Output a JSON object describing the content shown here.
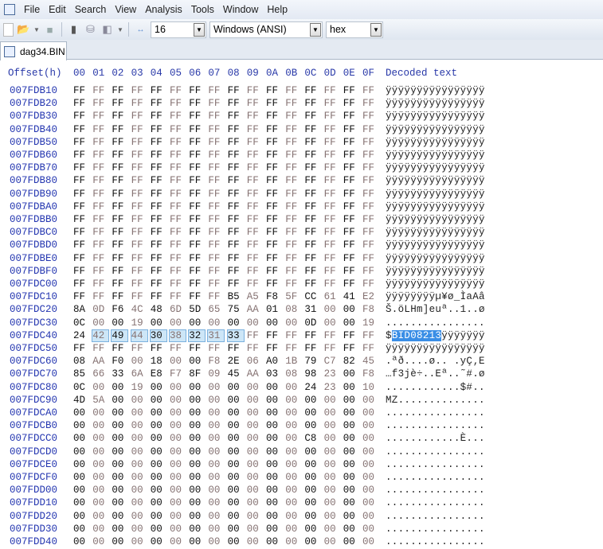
{
  "menu": [
    "File",
    "Edit",
    "Search",
    "View",
    "Analysis",
    "Tools",
    "Window",
    "Help"
  ],
  "toolbar": {
    "bytes_per_row": "16",
    "charset": "Windows (ANSI)",
    "display": "hex"
  },
  "tab": {
    "label": "dag34.BIN"
  },
  "header": {
    "offset": "Offset(h)",
    "columns": [
      "00",
      "01",
      "02",
      "03",
      "04",
      "05",
      "06",
      "07",
      "08",
      "09",
      "0A",
      "0B",
      "0C",
      "0D",
      "0E",
      "0F"
    ],
    "decoded": "Decoded text"
  },
  "selection": {
    "row": "007FDC40",
    "start": 1,
    "length": 8
  },
  "rows": [
    {
      "offset": "007FDB10",
      "bytes": "FF FF FF FF FF FF FF FF FF FF FF FF FF FF FF FF",
      "text": "ÿÿÿÿÿÿÿÿÿÿÿÿÿÿÿÿ"
    },
    {
      "offset": "007FDB20",
      "bytes": "FF FF FF FF FF FF FF FF FF FF FF FF FF FF FF FF",
      "text": "ÿÿÿÿÿÿÿÿÿÿÿÿÿÿÿÿ"
    },
    {
      "offset": "007FDB30",
      "bytes": "FF FF FF FF FF FF FF FF FF FF FF FF FF FF FF FF",
      "text": "ÿÿÿÿÿÿÿÿÿÿÿÿÿÿÿÿ"
    },
    {
      "offset": "007FDB40",
      "bytes": "FF FF FF FF FF FF FF FF FF FF FF FF FF FF FF FF",
      "text": "ÿÿÿÿÿÿÿÿÿÿÿÿÿÿÿÿ"
    },
    {
      "offset": "007FDB50",
      "bytes": "FF FF FF FF FF FF FF FF FF FF FF FF FF FF FF FF",
      "text": "ÿÿÿÿÿÿÿÿÿÿÿÿÿÿÿÿ"
    },
    {
      "offset": "007FDB60",
      "bytes": "FF FF FF FF FF FF FF FF FF FF FF FF FF FF FF FF",
      "text": "ÿÿÿÿÿÿÿÿÿÿÿÿÿÿÿÿ"
    },
    {
      "offset": "007FDB70",
      "bytes": "FF FF FF FF FF FF FF FF FF FF FF FF FF FF FF FF",
      "text": "ÿÿÿÿÿÿÿÿÿÿÿÿÿÿÿÿ"
    },
    {
      "offset": "007FDB80",
      "bytes": "FF FF FF FF FF FF FF FF FF FF FF FF FF FF FF FF",
      "text": "ÿÿÿÿÿÿÿÿÿÿÿÿÿÿÿÿ"
    },
    {
      "offset": "007FDB90",
      "bytes": "FF FF FF FF FF FF FF FF FF FF FF FF FF FF FF FF",
      "text": "ÿÿÿÿÿÿÿÿÿÿÿÿÿÿÿÿ"
    },
    {
      "offset": "007FDBA0",
      "bytes": "FF FF FF FF FF FF FF FF FF FF FF FF FF FF FF FF",
      "text": "ÿÿÿÿÿÿÿÿÿÿÿÿÿÿÿÿ"
    },
    {
      "offset": "007FDBB0",
      "bytes": "FF FF FF FF FF FF FF FF FF FF FF FF FF FF FF FF",
      "text": "ÿÿÿÿÿÿÿÿÿÿÿÿÿÿÿÿ"
    },
    {
      "offset": "007FDBC0",
      "bytes": "FF FF FF FF FF FF FF FF FF FF FF FF FF FF FF FF",
      "text": "ÿÿÿÿÿÿÿÿÿÿÿÿÿÿÿÿ"
    },
    {
      "offset": "007FDBD0",
      "bytes": "FF FF FF FF FF FF FF FF FF FF FF FF FF FF FF FF",
      "text": "ÿÿÿÿÿÿÿÿÿÿÿÿÿÿÿÿ"
    },
    {
      "offset": "007FDBE0",
      "bytes": "FF FF FF FF FF FF FF FF FF FF FF FF FF FF FF FF",
      "text": "ÿÿÿÿÿÿÿÿÿÿÿÿÿÿÿÿ"
    },
    {
      "offset": "007FDBF0",
      "bytes": "FF FF FF FF FF FF FF FF FF FF FF FF FF FF FF FF",
      "text": "ÿÿÿÿÿÿÿÿÿÿÿÿÿÿÿÿ"
    },
    {
      "offset": "007FDC00",
      "bytes": "FF FF FF FF FF FF FF FF FF FF FF FF FF FF FF FF",
      "text": "ÿÿÿÿÿÿÿÿÿÿÿÿÿÿÿÿ"
    },
    {
      "offset": "007FDC10",
      "bytes": "FF FF FF FF FF FF FF FF B5 A5 F8 5F CC 61 41 E2",
      "text": "ÿÿÿÿÿÿÿÿµ¥ø_ÌaAâ"
    },
    {
      "offset": "007FDC20",
      "bytes": "8A 0D F6 4C 48 6D 5D 65 75 AA 01 08 31 00 00 F8",
      "text": "Š.öLHm]euª..1..ø"
    },
    {
      "offset": "007FDC30",
      "bytes": "0C 00 00 19 00 00 00 00 00 00 00 00 0D 00 00 19",
      "text": "................"
    },
    {
      "offset": "007FDC40",
      "bytes": "24 42 49 44 30 38 32 31 33 FF FF FF FF FF FF FF",
      "text": "$BID08213ÿÿÿÿÿÿÿ"
    },
    {
      "offset": "007FDC50",
      "bytes": "FF FF FF FF FF FF FF FF FF FF FF FF FF FF FF FF",
      "text": "ÿÿÿÿÿÿÿÿÿÿÿÿÿÿÿÿ"
    },
    {
      "offset": "007FDC60",
      "bytes": "08 AA F0 00 18 00 00 F8 2E 06 A0 1B 79 C7 82 45",
      "text": ".ªð....ø.. .yÇ‚E"
    },
    {
      "offset": "007FDC70",
      "bytes": "85 66 33 6A E8 F7 8F 09 45 AA 03 08 98 23 00 F8",
      "text": "…f3jè÷..Eª..˜#.ø"
    },
    {
      "offset": "007FDC80",
      "bytes": "0C 00 00 19 00 00 00 00 00 00 00 00 24 23 00 10",
      "text": "............$#.."
    },
    {
      "offset": "007FDC90",
      "bytes": "4D 5A 00 00 00 00 00 00 00 00 00 00 00 00 00 00",
      "text": "MZ.............."
    },
    {
      "offset": "007FDCA0",
      "bytes": "00 00 00 00 00 00 00 00 00 00 00 00 00 00 00 00",
      "text": "................"
    },
    {
      "offset": "007FDCB0",
      "bytes": "00 00 00 00 00 00 00 00 00 00 00 00 00 00 00 00",
      "text": "................"
    },
    {
      "offset": "007FDCC0",
      "bytes": "00 00 00 00 00 00 00 00 00 00 00 00 C8 00 00 00",
      "text": "............È..."
    },
    {
      "offset": "007FDCD0",
      "bytes": "00 00 00 00 00 00 00 00 00 00 00 00 00 00 00 00",
      "text": "................"
    },
    {
      "offset": "007FDCE0",
      "bytes": "00 00 00 00 00 00 00 00 00 00 00 00 00 00 00 00",
      "text": "................"
    },
    {
      "offset": "007FDCF0",
      "bytes": "00 00 00 00 00 00 00 00 00 00 00 00 00 00 00 00",
      "text": "................"
    },
    {
      "offset": "007FDD00",
      "bytes": "00 00 00 00 00 00 00 00 00 00 00 00 00 00 00 00",
      "text": "................"
    },
    {
      "offset": "007FDD10",
      "bytes": "00 00 00 00 00 00 00 00 00 00 00 00 00 00 00 00",
      "text": "................"
    },
    {
      "offset": "007FDD20",
      "bytes": "00 00 00 00 00 00 00 00 00 00 00 00 00 00 00 00",
      "text": "................"
    },
    {
      "offset": "007FDD30",
      "bytes": "00 00 00 00 00 00 00 00 00 00 00 00 00 00 00 00",
      "text": "................"
    },
    {
      "offset": "007FDD40",
      "bytes": "00 00 00 00 00 00 00 00 00 00 00 00 00 00 00 00",
      "text": "................"
    }
  ]
}
